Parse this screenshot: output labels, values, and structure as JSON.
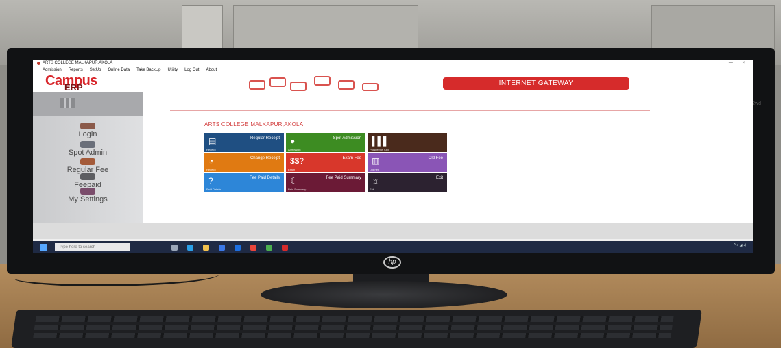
{
  "window": {
    "title": "ARTS COLLEGE MALKAPUR,AKOLA"
  },
  "menu": {
    "items": [
      "Admission",
      "Reports",
      "SetUp",
      "Online Data",
      "Take BackUp",
      "Utility",
      "Log Out",
      "About"
    ]
  },
  "header": {
    "logo_main": "Campus",
    "logo_sub": "ERP",
    "gateway": "INTERNET GATEWAY"
  },
  "sidebar": {
    "items": [
      {
        "label": "Login",
        "icon": "login-icon",
        "color": "#8b5a4a"
      },
      {
        "label": "Spot Admin",
        "icon": "spot-admin-icon",
        "color": "#6a6f7a"
      },
      {
        "label": "Regular Fee",
        "icon": "regular-fee-icon",
        "color": "#a45b3a"
      },
      {
        "label": "Feepaid",
        "icon": "feepaid-icon",
        "color": "#5d5e62"
      },
      {
        "label": "My Settings",
        "icon": "settings-icon",
        "color": "#7a4c6b"
      }
    ]
  },
  "main": {
    "college_name": "ARTS COLLEGE MALKAPUR,AKOLA",
    "tiles": [
      {
        "label": "Regular Receipt",
        "sub": "Receipt",
        "color": "#1f4f82",
        "icon": "receipt-icon"
      },
      {
        "label": "Spot Admission",
        "sub": "Admission",
        "color": "#3d8c22",
        "icon": "person-icon"
      },
      {
        "label": "",
        "sub": "Prospectus Cell",
        "color": "#4a2a1c",
        "icon": "bar-icon"
      },
      {
        "label": "Change Receipt",
        "sub": "Receipt",
        "color": "#e07a12",
        "icon": "pie-icon"
      },
      {
        "label": "Exam Fee",
        "sub": "Exam",
        "color": "#d8372b",
        "icon": "dollar-icon"
      },
      {
        "label": "Old Fee",
        "sub": "Old Fee",
        "color": "#8a55b6",
        "icon": "book-icon"
      },
      {
        "label": "Fee Paid Details",
        "sub": "Paid Details",
        "color": "#2d86d8",
        "icon": "question-icon"
      },
      {
        "label": "Fee Paid Summary",
        "sub": "Paid Summary",
        "color": "#6b1a36",
        "icon": "moon-icon"
      },
      {
        "label": "Exit",
        "sub": "Exit",
        "color": "#2c2230",
        "icon": "sun-icon"
      }
    ]
  },
  "taskbar": {
    "search_placeholder": "Type here to search"
  },
  "monitor": {
    "brand": "hp",
    "model": "22wd"
  }
}
